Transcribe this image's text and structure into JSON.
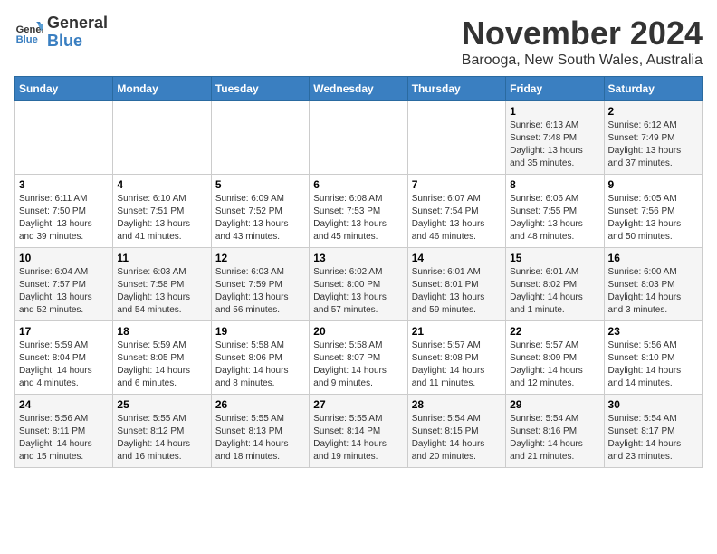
{
  "logo": {
    "line1": "General",
    "line2": "Blue"
  },
  "title": "November 2024",
  "location": "Barooga, New South Wales, Australia",
  "days_of_week": [
    "Sunday",
    "Monday",
    "Tuesday",
    "Wednesday",
    "Thursday",
    "Friday",
    "Saturday"
  ],
  "weeks": [
    [
      {
        "day": "",
        "info": ""
      },
      {
        "day": "",
        "info": ""
      },
      {
        "day": "",
        "info": ""
      },
      {
        "day": "",
        "info": ""
      },
      {
        "day": "",
        "info": ""
      },
      {
        "day": "1",
        "info": "Sunrise: 6:13 AM\nSunset: 7:48 PM\nDaylight: 13 hours\nand 35 minutes."
      },
      {
        "day": "2",
        "info": "Sunrise: 6:12 AM\nSunset: 7:49 PM\nDaylight: 13 hours\nand 37 minutes."
      }
    ],
    [
      {
        "day": "3",
        "info": "Sunrise: 6:11 AM\nSunset: 7:50 PM\nDaylight: 13 hours\nand 39 minutes."
      },
      {
        "day": "4",
        "info": "Sunrise: 6:10 AM\nSunset: 7:51 PM\nDaylight: 13 hours\nand 41 minutes."
      },
      {
        "day": "5",
        "info": "Sunrise: 6:09 AM\nSunset: 7:52 PM\nDaylight: 13 hours\nand 43 minutes."
      },
      {
        "day": "6",
        "info": "Sunrise: 6:08 AM\nSunset: 7:53 PM\nDaylight: 13 hours\nand 45 minutes."
      },
      {
        "day": "7",
        "info": "Sunrise: 6:07 AM\nSunset: 7:54 PM\nDaylight: 13 hours\nand 46 minutes."
      },
      {
        "day": "8",
        "info": "Sunrise: 6:06 AM\nSunset: 7:55 PM\nDaylight: 13 hours\nand 48 minutes."
      },
      {
        "day": "9",
        "info": "Sunrise: 6:05 AM\nSunset: 7:56 PM\nDaylight: 13 hours\nand 50 minutes."
      }
    ],
    [
      {
        "day": "10",
        "info": "Sunrise: 6:04 AM\nSunset: 7:57 PM\nDaylight: 13 hours\nand 52 minutes."
      },
      {
        "day": "11",
        "info": "Sunrise: 6:03 AM\nSunset: 7:58 PM\nDaylight: 13 hours\nand 54 minutes."
      },
      {
        "day": "12",
        "info": "Sunrise: 6:03 AM\nSunset: 7:59 PM\nDaylight: 13 hours\nand 56 minutes."
      },
      {
        "day": "13",
        "info": "Sunrise: 6:02 AM\nSunset: 8:00 PM\nDaylight: 13 hours\nand 57 minutes."
      },
      {
        "day": "14",
        "info": "Sunrise: 6:01 AM\nSunset: 8:01 PM\nDaylight: 13 hours\nand 59 minutes."
      },
      {
        "day": "15",
        "info": "Sunrise: 6:01 AM\nSunset: 8:02 PM\nDaylight: 14 hours\nand 1 minute."
      },
      {
        "day": "16",
        "info": "Sunrise: 6:00 AM\nSunset: 8:03 PM\nDaylight: 14 hours\nand 3 minutes."
      }
    ],
    [
      {
        "day": "17",
        "info": "Sunrise: 5:59 AM\nSunset: 8:04 PM\nDaylight: 14 hours\nand 4 minutes."
      },
      {
        "day": "18",
        "info": "Sunrise: 5:59 AM\nSunset: 8:05 PM\nDaylight: 14 hours\nand 6 minutes."
      },
      {
        "day": "19",
        "info": "Sunrise: 5:58 AM\nSunset: 8:06 PM\nDaylight: 14 hours\nand 8 minutes."
      },
      {
        "day": "20",
        "info": "Sunrise: 5:58 AM\nSunset: 8:07 PM\nDaylight: 14 hours\nand 9 minutes."
      },
      {
        "day": "21",
        "info": "Sunrise: 5:57 AM\nSunset: 8:08 PM\nDaylight: 14 hours\nand 11 minutes."
      },
      {
        "day": "22",
        "info": "Sunrise: 5:57 AM\nSunset: 8:09 PM\nDaylight: 14 hours\nand 12 minutes."
      },
      {
        "day": "23",
        "info": "Sunrise: 5:56 AM\nSunset: 8:10 PM\nDaylight: 14 hours\nand 14 minutes."
      }
    ],
    [
      {
        "day": "24",
        "info": "Sunrise: 5:56 AM\nSunset: 8:11 PM\nDaylight: 14 hours\nand 15 minutes."
      },
      {
        "day": "25",
        "info": "Sunrise: 5:55 AM\nSunset: 8:12 PM\nDaylight: 14 hours\nand 16 minutes."
      },
      {
        "day": "26",
        "info": "Sunrise: 5:55 AM\nSunset: 8:13 PM\nDaylight: 14 hours\nand 18 minutes."
      },
      {
        "day": "27",
        "info": "Sunrise: 5:55 AM\nSunset: 8:14 PM\nDaylight: 14 hours\nand 19 minutes."
      },
      {
        "day": "28",
        "info": "Sunrise: 5:54 AM\nSunset: 8:15 PM\nDaylight: 14 hours\nand 20 minutes."
      },
      {
        "day": "29",
        "info": "Sunrise: 5:54 AM\nSunset: 8:16 PM\nDaylight: 14 hours\nand 21 minutes."
      },
      {
        "day": "30",
        "info": "Sunrise: 5:54 AM\nSunset: 8:17 PM\nDaylight: 14 hours\nand 23 minutes."
      }
    ]
  ]
}
